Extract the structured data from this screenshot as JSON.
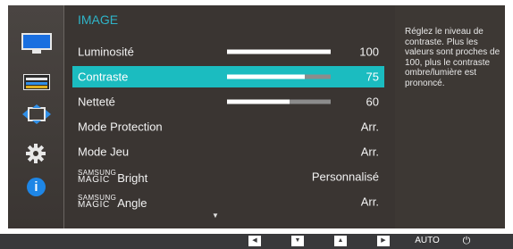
{
  "menu": {
    "title": "IMAGE",
    "items": [
      {
        "label": "Luminosité",
        "value": "100",
        "level": 100
      },
      {
        "label": "Contraste",
        "value": "75",
        "level": 75
      },
      {
        "label": "Netteté",
        "value": "60",
        "level": 60
      },
      {
        "label": "Mode Protection",
        "value": "Arr."
      },
      {
        "label": "Mode Jeu",
        "value": "Arr."
      },
      {
        "brand_top": "SAMSUNG",
        "brand_bottom": "MAGIC",
        "label": "Bright",
        "value": "Personnalisé"
      },
      {
        "brand_top": "SAMSUNG",
        "brand_bottom": "MAGIC",
        "label": "Angle",
        "value": "Arr."
      }
    ],
    "scroll_indicator": "▼"
  },
  "help": {
    "text": "Réglez le niveau de contraste. Plus les valeurs sont proches de 100, plus le contraste ombre/lumière est prononcé."
  },
  "sidebar": {
    "icons": [
      "picture-icon",
      "color-icon",
      "screen-size-icon",
      "gear-icon",
      "info-icon"
    ],
    "info_glyph": "i"
  },
  "bottom_bar": {
    "left_glyph": "◀",
    "down_glyph": "▼",
    "up_glyph": "▲",
    "right_glyph": "▶",
    "auto_label": "AUTO",
    "power_glyph": "⏻"
  },
  "colors": {
    "accent": "#1bbcc0",
    "title": "#2fb4c8",
    "background": "#3a3532",
    "info_icon": "#1e86e6",
    "picture_icon": "#1a6fe0"
  }
}
